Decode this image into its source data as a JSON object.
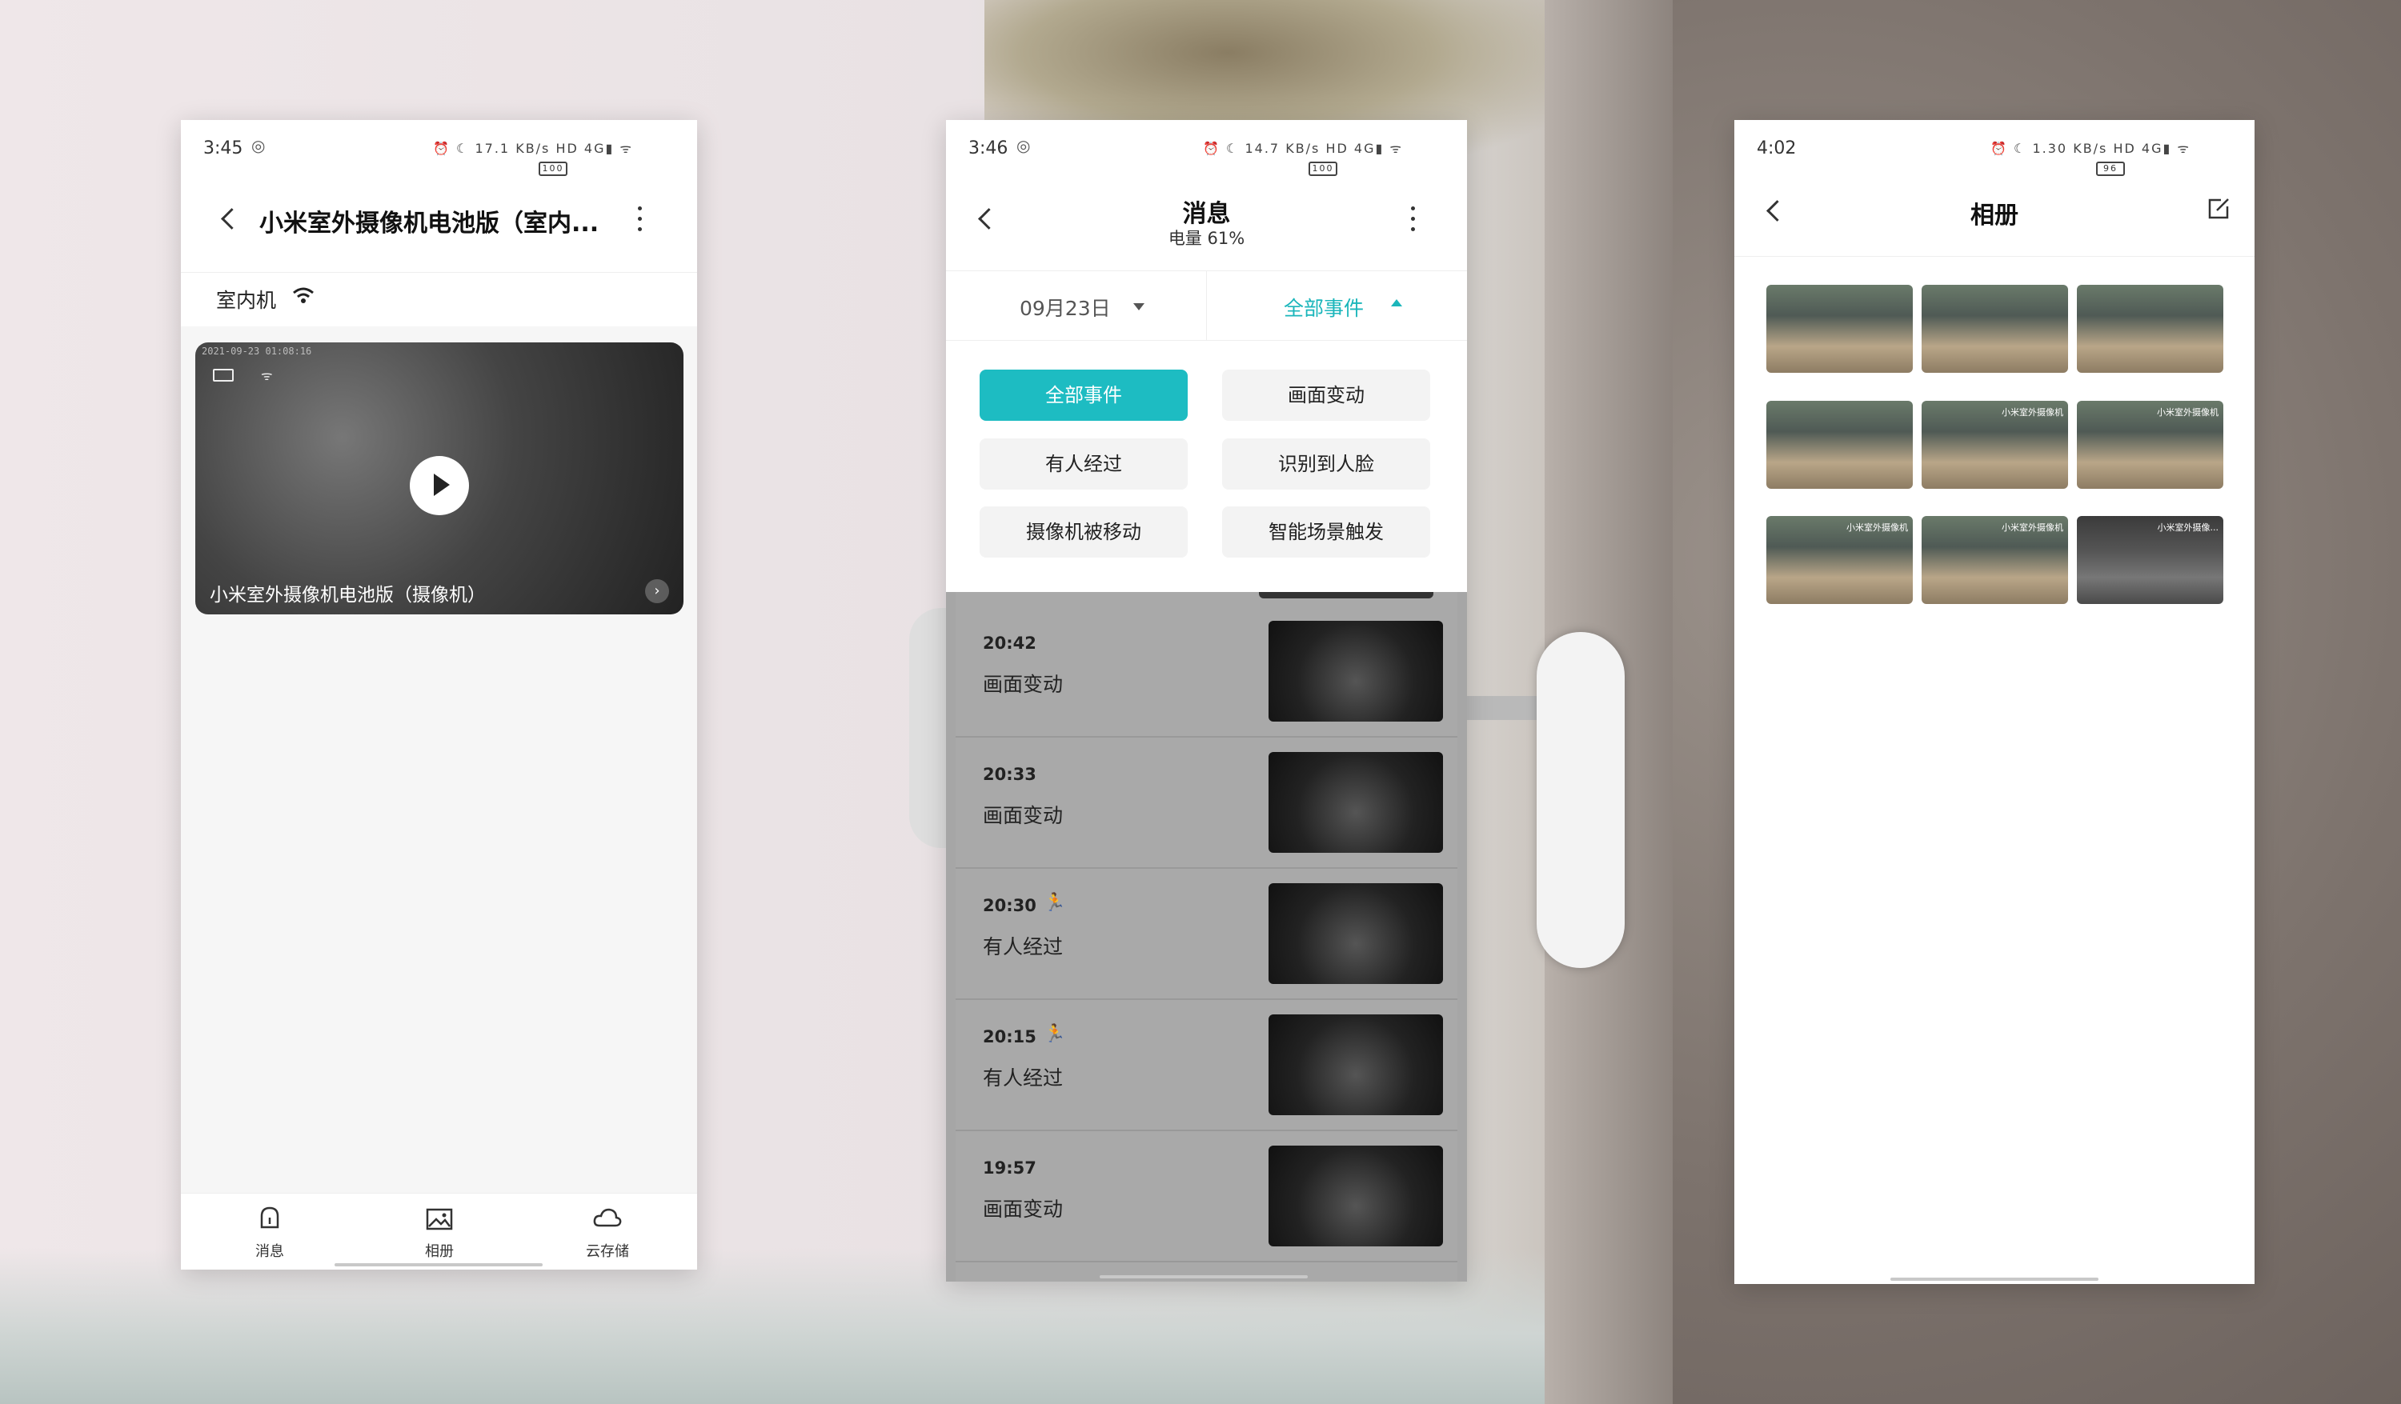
{
  "screen1": {
    "status": {
      "time": "3:45",
      "speed": "17.1 KB/s",
      "net": "4G",
      "battery": "100"
    },
    "title": "小米室外摄像机电池版（室内...",
    "section_label": "室内机",
    "video": {
      "timestamp": "2021-09-23 01:08:16",
      "caption": "小米室外摄像机电池版（摄像机）"
    },
    "tabs": [
      {
        "label": "消息",
        "icon": "bell-icon"
      },
      {
        "label": "相册",
        "icon": "album-icon"
      },
      {
        "label": "云存储",
        "icon": "cloud-icon"
      }
    ]
  },
  "screen2": {
    "status": {
      "time": "3:46",
      "speed": "14.7 KB/s",
      "net": "4G",
      "battery": "100"
    },
    "title": "消息",
    "subtitle": "电量 61%",
    "date_filter": "09月23日",
    "event_filter": "全部事件",
    "chips": [
      "全部事件",
      "画面变动",
      "有人经过",
      "识别到人脸",
      "摄像机被移动",
      "智能场景触发"
    ],
    "events": [
      {
        "time": "20:42",
        "type": "画面变动",
        "person": false
      },
      {
        "time": "20:33",
        "type": "画面变动",
        "person": false
      },
      {
        "time": "20:30",
        "type": "有人经过",
        "person": true
      },
      {
        "time": "20:15",
        "type": "有人经过",
        "person": true
      },
      {
        "time": "19:57",
        "type": "画面变动",
        "person": false
      }
    ]
  },
  "screen3": {
    "status": {
      "time": "4:02",
      "speed": "1.30 KB/s",
      "net": "4G",
      "battery": "96"
    },
    "title": "相册",
    "thumbs": [
      {
        "label": ""
      },
      {
        "label": ""
      },
      {
        "label": ""
      },
      {
        "label": ""
      },
      {
        "label": "小米室外摄像机"
      },
      {
        "label": "小米室外摄像机"
      },
      {
        "label": "小米室外摄像机"
      },
      {
        "label": "小米室外摄像机"
      },
      {
        "label": "小米室外摄像..."
      }
    ]
  }
}
